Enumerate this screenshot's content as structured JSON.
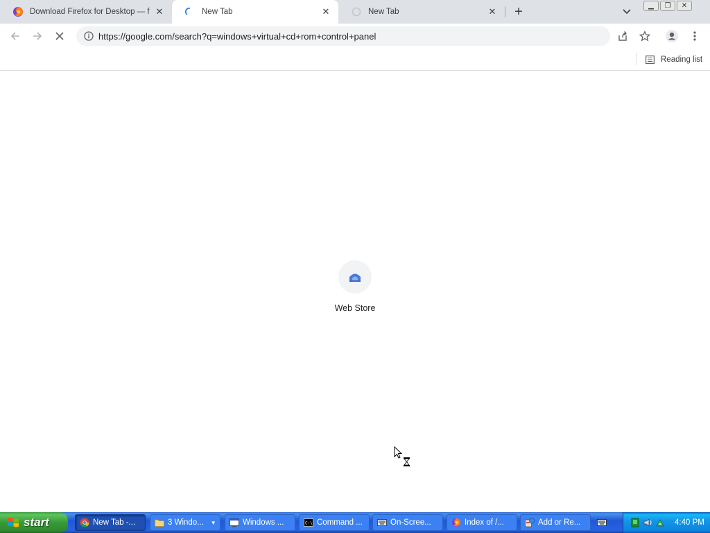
{
  "tabs": [
    {
      "title": "Download Firefox for Desktop — from Mozilla",
      "icon": "firefox-icon",
      "state": "inactive"
    },
    {
      "title": "New Tab",
      "icon": "loading-spinner-icon",
      "state": "active"
    },
    {
      "title": "New Tab",
      "icon": "loading-circle-icon",
      "state": "inactive"
    }
  ],
  "toolbar": {
    "url": "https://google.com/search?q=windows+virtual+cd+rom+control+panel"
  },
  "bookmarks": {
    "reading_list": "Reading list"
  },
  "content": {
    "shortcut_label": "Web Store"
  },
  "taskbar": {
    "start_label": "start",
    "tasks": [
      {
        "label": "New Tab -...",
        "icon": "chrome-icon",
        "active": true
      },
      {
        "label": "3 Windo...",
        "icon": "folder-icon",
        "active": false,
        "group_arrow": "▼"
      },
      {
        "label": "Windows ...",
        "icon": "window-icon",
        "active": false
      },
      {
        "label": "Command ...",
        "icon": "command-prompt-icon",
        "active": false
      },
      {
        "label": "On-Scree...",
        "icon": "keyboard-icon",
        "active": false
      },
      {
        "label": "Index of /...",
        "icon": "firefox-icon",
        "active": false
      },
      {
        "label": "Add or Re...",
        "icon": "add-remove-programs-icon",
        "active": false
      }
    ],
    "clock": "4:40 PM"
  },
  "colors": {
    "tabstrip_bg": "#dee1e6",
    "omnibox_bg": "#f1f3f4",
    "taskbar_blue": "#2157d7",
    "start_green": "#379937",
    "tray_blue": "#1297e8"
  }
}
